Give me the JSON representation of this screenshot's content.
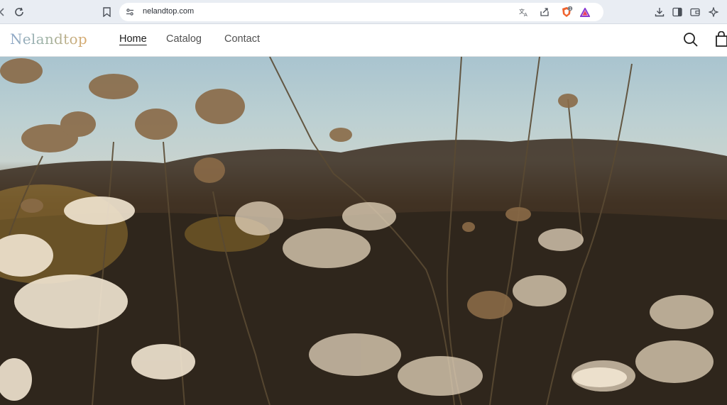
{
  "browser": {
    "url": "nelandtop.com",
    "icons": [
      "back-arrow-icon",
      "reload-icon",
      "bookmark-icon",
      "site-info-icon",
      "translate-icon",
      "share-icon",
      "brave-shield-icon",
      "brave-rewards-icon",
      "download-icon",
      "sidebar-icon",
      "wallet-icon",
      "leo-ai-icon"
    ],
    "shield_badge": "1"
  },
  "site": {
    "logo": "Nelandtop",
    "nav": [
      {
        "label": "Home",
        "active": true
      },
      {
        "label": "Catalog",
        "active": false
      },
      {
        "label": "Contact",
        "active": false
      }
    ],
    "header_icons": [
      "search-icon",
      "cart-icon"
    ]
  },
  "hero": {
    "alt": "hero-image-wildflowers"
  }
}
